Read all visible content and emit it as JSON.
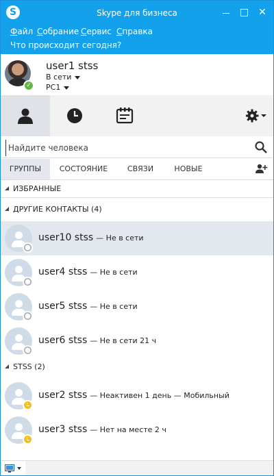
{
  "window": {
    "title": "Skype для бизнеса",
    "logo_letter": "S"
  },
  "menu": [
    {
      "underline": "Ф",
      "rest": "айл"
    },
    {
      "underline": "С",
      "rest": "обрание"
    },
    {
      "underline": "С",
      "rest": "ервис"
    },
    {
      "underline": "С",
      "rest": "правка"
    }
  ],
  "whatsup": "Что происходит сегодня?",
  "profile": {
    "name": "user1 stss",
    "status": "В сети",
    "location": "PC1"
  },
  "search": {
    "placeholder": "Найдите человека"
  },
  "subtabs": {
    "groups": "ГРУППЫ",
    "status": "СОСТОЯНИЕ",
    "links": "СВЯЗИ",
    "new": "НОВЫЕ"
  },
  "groups": {
    "favorites": "ИЗБРАННЫЕ",
    "other": "ДРУГИЕ КОНТАКТЫ (4)",
    "stss": "STSS (2)"
  },
  "contacts": [
    {
      "name": "user10 stss",
      "note": "— Не в сети"
    },
    {
      "name": "user4 stss",
      "note": "— Не в сети"
    },
    {
      "name": "user5 stss",
      "note": "— Не в сети"
    },
    {
      "name": "user6 stss",
      "note": "— Не в сети 21 ч"
    },
    {
      "name": "user2 stss",
      "note": "— Неактивен 1 день — Мобильный"
    },
    {
      "name": "user3 stss",
      "note": "— Нет на месте 2 ч"
    }
  ],
  "colors": {
    "accent": "#13a1ec",
    "online": "#64b746",
    "away": "#f2c01c"
  }
}
